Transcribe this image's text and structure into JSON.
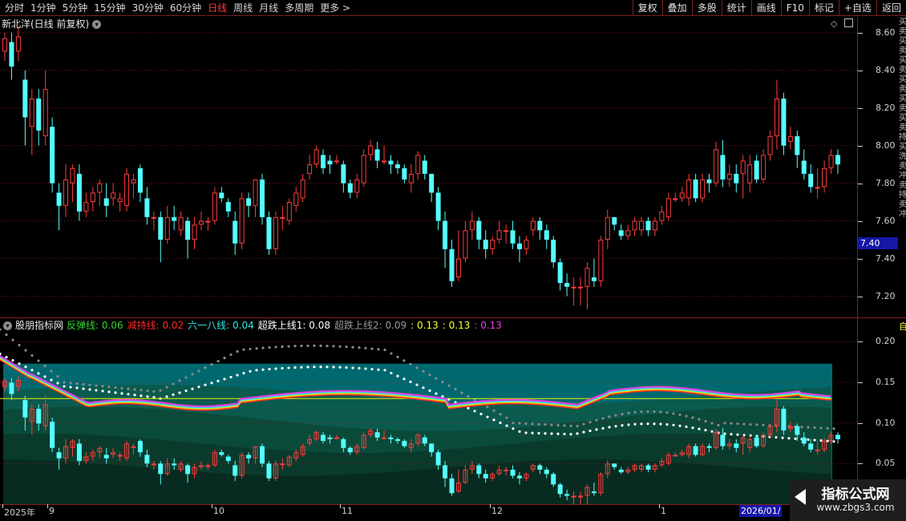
{
  "toolbar": {
    "periods": [
      "分时",
      "1分钟",
      "5分钟",
      "15分钟",
      "30分钟",
      "60分钟",
      "日线",
      "周线",
      "月线",
      "多周期",
      "更多 >"
    ],
    "active_period": "日线",
    "tools": [
      "复权",
      "叠加",
      "多股",
      "统计",
      "画线",
      "F10",
      "标记",
      "+自选",
      "返回"
    ]
  },
  "main_pane": {
    "title": "新北洋(日线 前复权)",
    "price_label": "7.40",
    "y_ticks": [
      "8.60",
      "8.40",
      "8.20",
      "8.00",
      "7.80",
      "7.60",
      "7.40",
      "7.20"
    ],
    "side_text": "买卖买卖买卖买卖买卖买卖持买洗卖冲卖持卖冲"
  },
  "indicator_pane": {
    "name": "股朋指标网",
    "items": [
      {
        "label": "反弹线: 0.06",
        "color": "#33d633"
      },
      {
        "label": "减持线: 0.02",
        "color": "#ff2a2a"
      },
      {
        "label": "六一八线: 0.04",
        "color": "#33e6e6"
      },
      {
        "label": "超跌上线1: 0.08",
        "color": "#ffffff"
      },
      {
        "label": "超跌上线2: 0.09",
        "color": "#9a9a9a"
      },
      {
        "label": ": 0.13",
        "color": "#ffff33"
      },
      {
        "label": ": 0.13",
        "color": "#ffff33"
      },
      {
        "label": ": 0.13",
        "color": "#e040e0"
      }
    ],
    "y_ticks": [
      "0.20",
      "0.15",
      "0.10",
      "0.05"
    ],
    "side_label": "自"
  },
  "date_axis": {
    "labels": [
      "2025年",
      "9",
      "10",
      "11",
      "12",
      "1"
    ],
    "cursor_date": "2026/01/"
  },
  "chart_data": {
    "type": "candlestick",
    "y_range": [
      7.1,
      8.65
    ],
    "close_price": 7.4,
    "candles": [
      [
        8.5,
        8.57,
        8.45,
        8.6
      ],
      [
        8.55,
        8.42,
        8.35,
        8.6
      ],
      [
        8.5,
        8.58,
        8.45,
        8.63
      ],
      [
        8.35,
        8.15,
        8.0,
        8.4
      ],
      [
        8.1,
        8.25,
        7.95,
        8.3
      ],
      [
        8.25,
        8.08,
        8.0,
        8.3
      ],
      [
        8.05,
        8.3,
        8.0,
        8.4
      ],
      [
        8.1,
        7.8,
        7.75,
        8.15
      ],
      [
        7.75,
        7.68,
        7.55,
        7.8
      ],
      [
        7.68,
        7.82,
        7.62,
        7.9
      ],
      [
        7.8,
        7.88,
        7.7,
        7.9
      ],
      [
        7.85,
        7.65,
        7.6,
        7.9
      ],
      [
        7.65,
        7.7,
        7.62,
        7.75
      ],
      [
        7.7,
        7.75,
        7.65,
        7.78
      ],
      [
        7.75,
        7.8,
        7.68,
        7.82
      ],
      [
        7.72,
        7.68,
        7.62,
        7.8
      ],
      [
        7.72,
        7.75,
        7.68,
        7.8
      ],
      [
        7.7,
        7.72,
        7.65,
        7.75
      ],
      [
        7.68,
        7.85,
        7.65,
        7.88
      ],
      [
        7.8,
        7.82,
        7.72,
        7.85
      ],
      [
        7.88,
        7.75,
        7.7,
        7.9
      ],
      [
        7.72,
        7.62,
        7.58,
        7.78
      ],
      [
        7.62,
        7.62,
        7.55,
        7.65
      ],
      [
        7.62,
        7.5,
        7.38,
        7.65
      ],
      [
        7.5,
        7.62,
        7.48,
        7.68
      ],
      [
        7.62,
        7.6,
        7.55,
        7.68
      ],
      [
        7.55,
        7.62,
        7.52,
        7.65
      ],
      [
        7.6,
        7.5,
        7.4,
        7.62
      ],
      [
        7.5,
        7.58,
        7.45,
        7.62
      ],
      [
        7.58,
        7.6,
        7.55,
        7.65
      ],
      [
        7.6,
        7.6,
        7.55,
        7.62
      ],
      [
        7.6,
        7.75,
        7.58,
        7.78
      ],
      [
        7.75,
        7.72,
        7.7,
        7.78
      ],
      [
        7.7,
        7.65,
        7.62,
        7.72
      ],
      [
        7.6,
        7.48,
        7.42,
        7.65
      ],
      [
        7.48,
        7.72,
        7.45,
        7.75
      ],
      [
        7.72,
        7.68,
        7.62,
        7.75
      ],
      [
        7.68,
        7.82,
        7.62,
        7.82
      ],
      [
        7.82,
        7.62,
        7.58,
        7.85
      ],
      [
        7.62,
        7.45,
        7.42,
        7.65
      ],
      [
        7.45,
        7.62,
        7.42,
        7.65
      ],
      [
        7.62,
        7.62,
        7.55,
        7.68
      ],
      [
        7.6,
        7.7,
        7.58,
        7.72
      ],
      [
        7.68,
        7.75,
        7.65,
        7.78
      ],
      [
        7.72,
        7.82,
        7.7,
        7.85
      ],
      [
        7.85,
        7.9,
        7.82,
        7.95
      ],
      [
        7.9,
        7.98,
        7.88,
        8.0
      ],
      [
        7.95,
        7.88,
        7.85,
        7.98
      ],
      [
        7.92,
        7.9,
        7.85,
        7.95
      ],
      [
        7.92,
        7.92,
        7.9,
        7.95
      ],
      [
        7.9,
        7.8,
        7.75,
        7.92
      ],
      [
        7.8,
        7.75,
        7.72,
        7.82
      ],
      [
        7.75,
        7.82,
        7.72,
        7.85
      ],
      [
        7.8,
        7.95,
        7.78,
        7.98
      ],
      [
        7.95,
        8.0,
        7.92,
        8.03
      ],
      [
        7.98,
        7.92,
        7.88,
        8.02
      ],
      [
        7.92,
        7.92,
        7.9,
        8.0
      ],
      [
        7.92,
        7.9,
        7.85,
        7.95
      ],
      [
        7.9,
        7.88,
        7.85,
        7.92
      ],
      [
        7.88,
        7.82,
        7.8,
        7.9
      ],
      [
        7.8,
        7.85,
        7.75,
        7.9
      ],
      [
        7.85,
        7.95,
        7.82,
        7.97
      ],
      [
        7.92,
        7.85,
        7.82,
        7.95
      ],
      [
        7.85,
        7.75,
        7.7,
        7.85
      ],
      [
        7.75,
        7.6,
        7.55,
        7.78
      ],
      [
        7.6,
        7.45,
        7.35,
        7.65
      ],
      [
        7.45,
        7.28,
        7.25,
        7.5
      ],
      [
        7.3,
        7.4,
        7.28,
        7.55
      ],
      [
        7.4,
        7.55,
        7.38,
        7.6
      ],
      [
        7.55,
        7.6,
        7.5,
        7.65
      ],
      [
        7.6,
        7.5,
        7.45,
        7.62
      ],
      [
        7.5,
        7.45,
        7.4,
        7.55
      ],
      [
        7.45,
        7.5,
        7.42,
        7.52
      ],
      [
        7.5,
        7.55,
        7.48,
        7.6
      ],
      [
        7.55,
        7.55,
        7.48,
        7.58
      ],
      [
        7.55,
        7.48,
        7.45,
        7.6
      ],
      [
        7.48,
        7.45,
        7.38,
        7.52
      ],
      [
        7.45,
        7.5,
        7.42,
        7.52
      ],
      [
        7.55,
        7.6,
        7.52,
        7.62
      ],
      [
        7.6,
        7.55,
        7.5,
        7.62
      ],
      [
        7.55,
        7.5,
        7.45,
        7.58
      ],
      [
        7.5,
        7.38,
        7.35,
        7.52
      ],
      [
        7.38,
        7.27,
        7.23,
        7.4
      ],
      [
        7.27,
        7.25,
        7.2,
        7.32
      ],
      [
        7.25,
        7.25,
        7.15,
        7.3
      ],
      [
        7.25,
        7.25,
        7.15,
        7.3
      ],
      [
        7.25,
        7.35,
        7.13,
        7.38
      ],
      [
        7.3,
        7.28,
        7.25,
        7.4
      ],
      [
        7.28,
        7.5,
        7.25,
        7.52
      ],
      [
        7.5,
        7.62,
        7.45,
        7.66
      ],
      [
        7.62,
        7.58,
        7.55,
        7.62
      ],
      [
        7.55,
        7.52,
        7.5,
        7.58
      ],
      [
        7.52,
        7.55,
        7.5,
        7.58
      ],
      [
        7.55,
        7.6,
        7.52,
        7.62
      ],
      [
        7.55,
        7.6,
        7.52,
        7.62
      ],
      [
        7.6,
        7.55,
        7.52,
        7.62
      ],
      [
        7.55,
        7.6,
        7.52,
        7.62
      ],
      [
        7.6,
        7.65,
        7.58,
        7.68
      ],
      [
        7.62,
        7.72,
        7.6,
        7.75
      ],
      [
        7.72,
        7.72,
        7.7,
        7.75
      ],
      [
        7.72,
        7.75,
        7.7,
        7.78
      ],
      [
        7.72,
        7.82,
        7.68,
        7.85
      ],
      [
        7.82,
        7.72,
        7.7,
        7.85
      ],
      [
        7.72,
        7.82,
        7.7,
        7.85
      ],
      [
        7.82,
        7.8,
        7.75,
        7.85
      ],
      [
        7.8,
        7.98,
        7.78,
        8.02
      ],
      [
        7.95,
        7.82,
        7.78,
        8.03
      ],
      [
        7.82,
        7.85,
        7.78,
        7.9
      ],
      [
        7.85,
        7.8,
        7.75,
        7.9
      ],
      [
        7.85,
        7.92,
        7.72,
        7.95
      ],
      [
        7.8,
        7.9,
        7.75,
        7.95
      ],
      [
        7.92,
        7.82,
        7.8,
        7.95
      ],
      [
        7.82,
        7.95,
        7.8,
        7.98
      ],
      [
        7.95,
        8.05,
        7.92,
        8.08
      ],
      [
        8.05,
        8.25,
        7.98,
        8.35
      ],
      [
        8.25,
        8.0,
        7.95,
        8.28
      ],
      [
        8.02,
        8.05,
        7.98,
        8.1
      ],
      [
        8.05,
        7.95,
        7.88,
        8.08
      ],
      [
        7.92,
        7.85,
        7.82,
        7.98
      ],
      [
        7.85,
        7.78,
        7.75,
        7.9
      ],
      [
        7.78,
        7.78,
        7.72,
        7.88
      ],
      [
        7.78,
        7.88,
        7.75,
        7.92
      ],
      [
        7.88,
        7.95,
        7.85,
        7.98
      ],
      [
        7.95,
        7.9,
        7.85,
        7.98
      ]
    ],
    "indicator_ylim": [
      0.0,
      0.225
    ]
  }
}
